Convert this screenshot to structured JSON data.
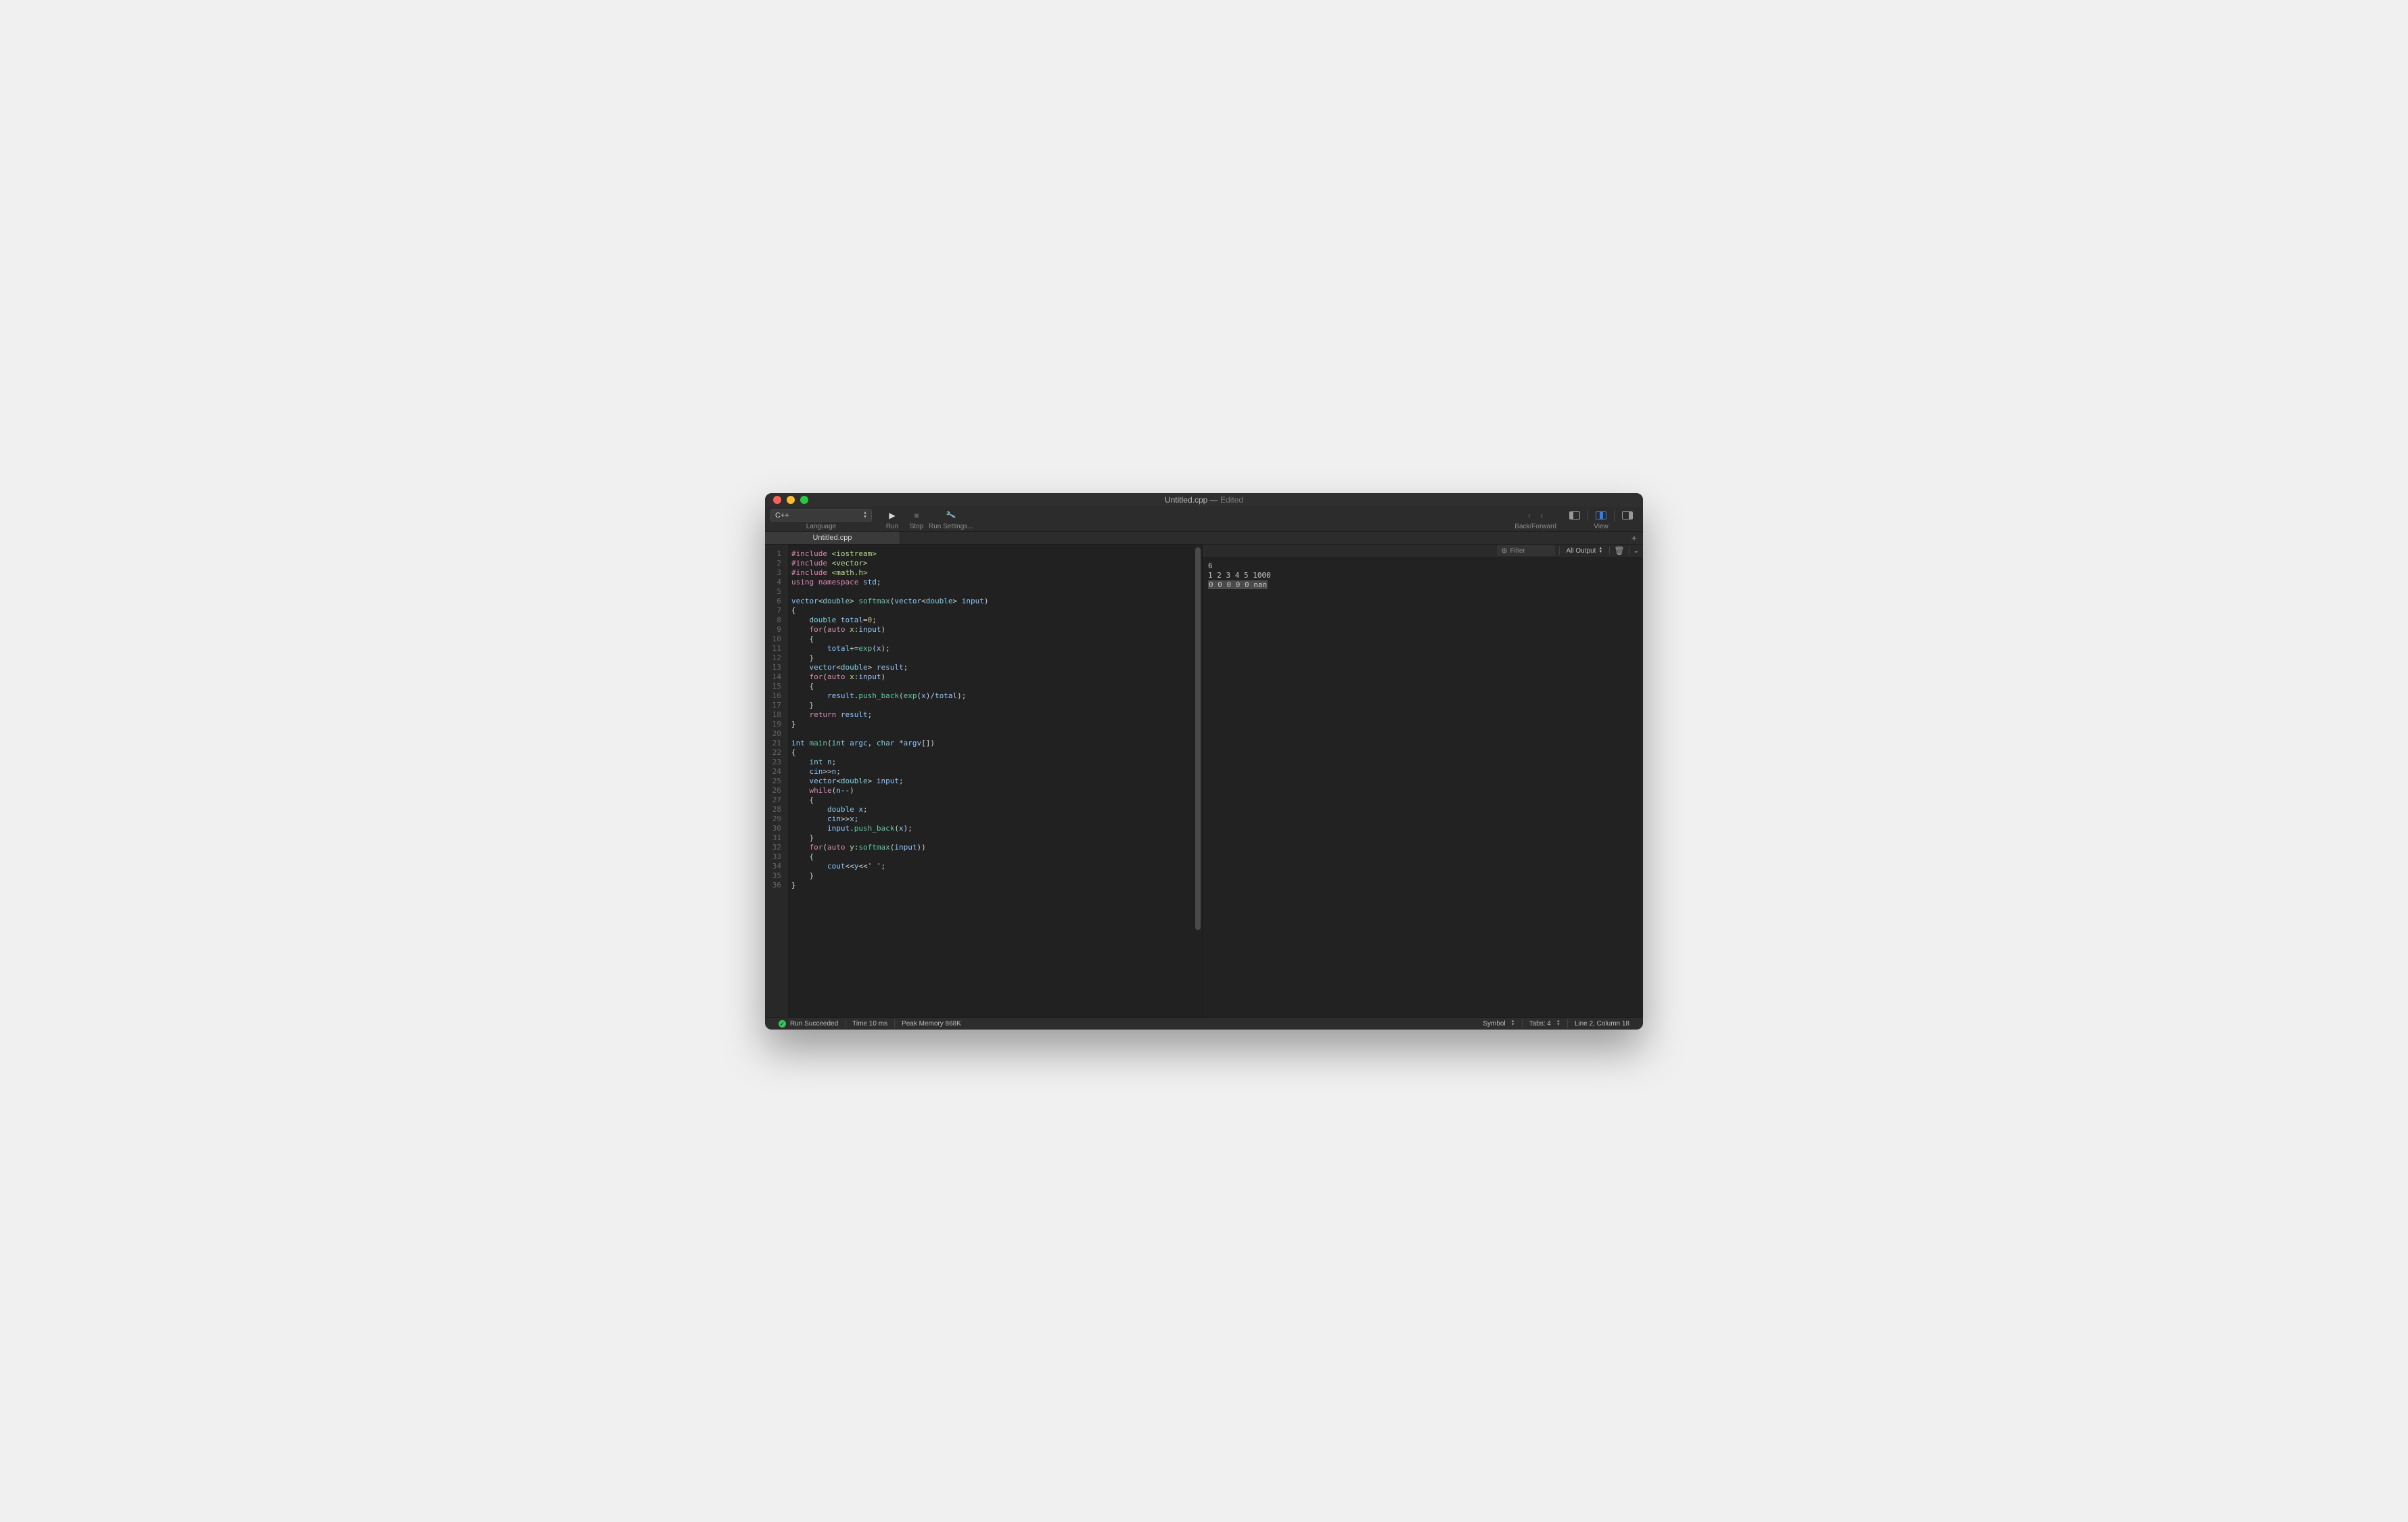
{
  "titlebar": {
    "filename": "Untitled.cpp",
    "sep": " — ",
    "edited": "Edited"
  },
  "toolbar": {
    "language": "C++",
    "language_label": "Language",
    "run_label": "Run",
    "stop_label": "Stop",
    "run_settings_label": "Run Settings...",
    "backforward_label": "Back/Forward",
    "view_label": "View"
  },
  "tab": {
    "name": "Untitled.cpp"
  },
  "editor": {
    "line_count": 36
  },
  "output": {
    "filter_placeholder": "Filter",
    "selector": "All Output",
    "lines": [
      "6",
      "1 2 3 4 5 1000",
      "0 0 0 0 0 nan"
    ]
  },
  "status": {
    "run": "Run Succeeded",
    "time": "Time 10 ms",
    "memory": "Peak Memory 868K",
    "symbol": "Symbol",
    "tabs": "Tabs: 4",
    "cursor": "Line 2, Column 18"
  }
}
